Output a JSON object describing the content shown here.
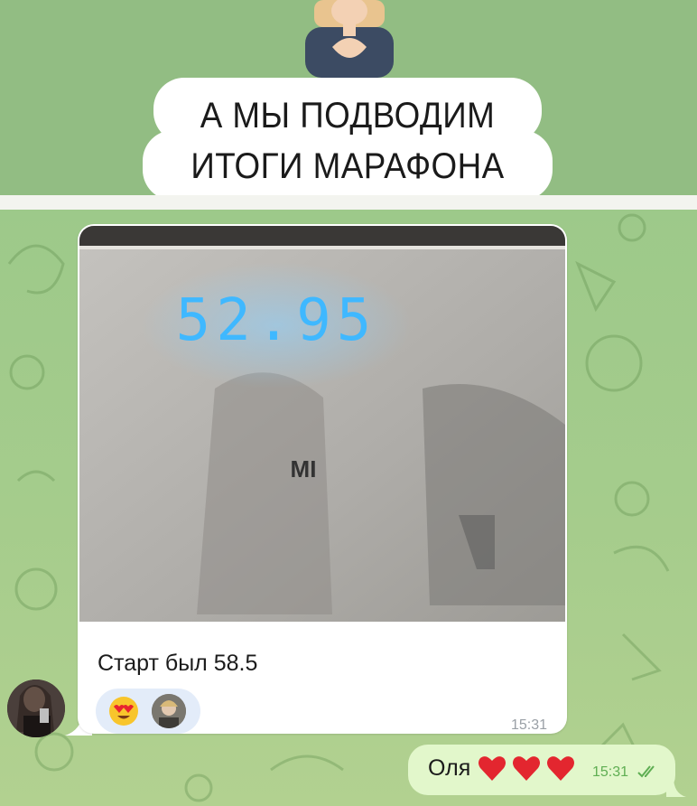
{
  "banner": {
    "title_line1": "А МЫ ПОДВОДИМ",
    "title_line2": "ИТОГИ МАРАФОНА"
  },
  "message": {
    "photo": {
      "scale_reading": "52.95",
      "scale_brand": "MI"
    },
    "caption": "Старт был 58.5",
    "reaction_emoji": "heart-eyes-emoji",
    "time": "15:31"
  },
  "outgoing": {
    "text": "Оля",
    "hearts": [
      "❤️",
      "❤️",
      "❤️"
    ],
    "time": "15:31"
  },
  "colors": {
    "chat_bg": "#a5cc8c",
    "outgoing_bubble": "#e2f7cb",
    "incoming_bubble": "#ffffff",
    "scale_display": "#3fb8ff",
    "read_check": "#5fae53"
  }
}
